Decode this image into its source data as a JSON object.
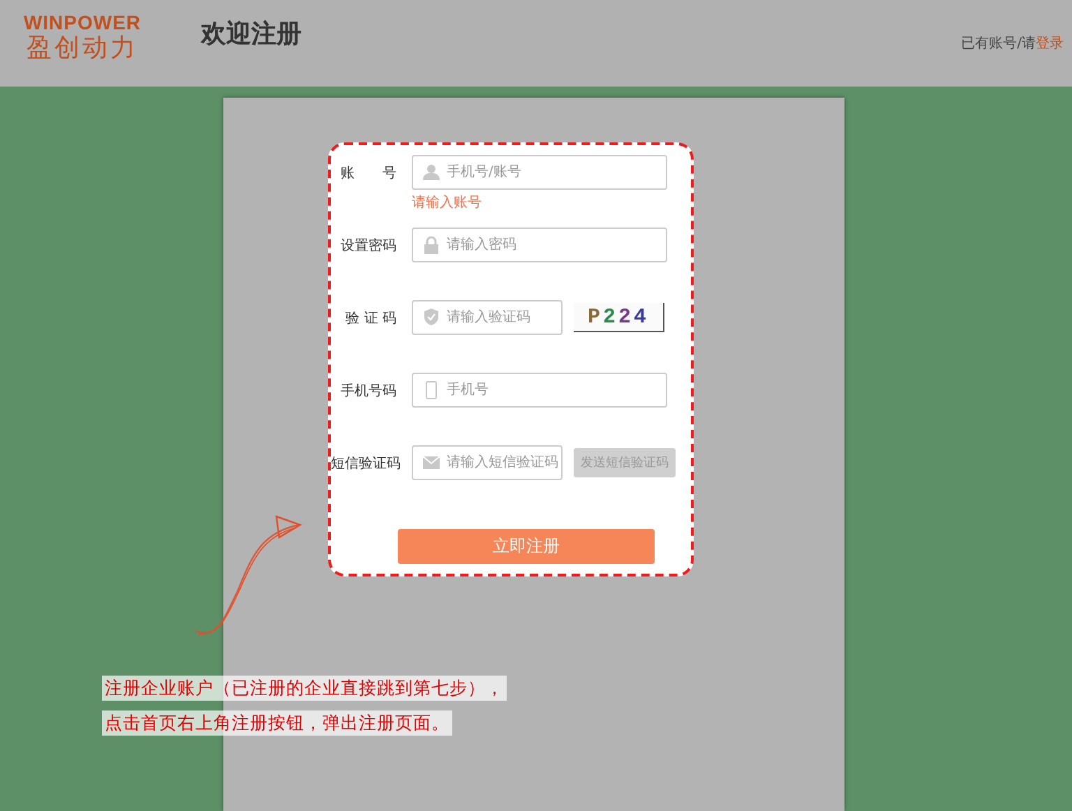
{
  "header": {
    "logo": {
      "wordmark": "WINPOWER",
      "name": "盈创动力"
    },
    "title": "欢迎注册",
    "login_prompt": {
      "text": "已有账号/请",
      "link": "登录"
    }
  },
  "form": {
    "fields": [
      {
        "kind": "account",
        "label": "账　　号",
        "placeholder": "手机号/账号",
        "error": "请输入账号"
      },
      {
        "kind": "password",
        "label": "设置密码",
        "placeholder": "请输入密码"
      },
      {
        "kind": "captcha",
        "label": "验 证 码",
        "placeholder": "请输入验证码",
        "captcha": "P224"
      },
      {
        "kind": "phone",
        "label": "手机号码",
        "placeholder": "手机号"
      },
      {
        "kind": "sms",
        "label": "短信验证码",
        "placeholder": "请输入短信验证码",
        "send_button": {
          "label": "发送短信验证码",
          "disabled": true
        }
      }
    ],
    "submit": "立即注册"
  },
  "annotation": {
    "lines": [
      "注册企业账户（已注册的企业直接跳到第七步），",
      "点击首页右上角注册按钮，弹出注册页面。"
    ]
  }
}
